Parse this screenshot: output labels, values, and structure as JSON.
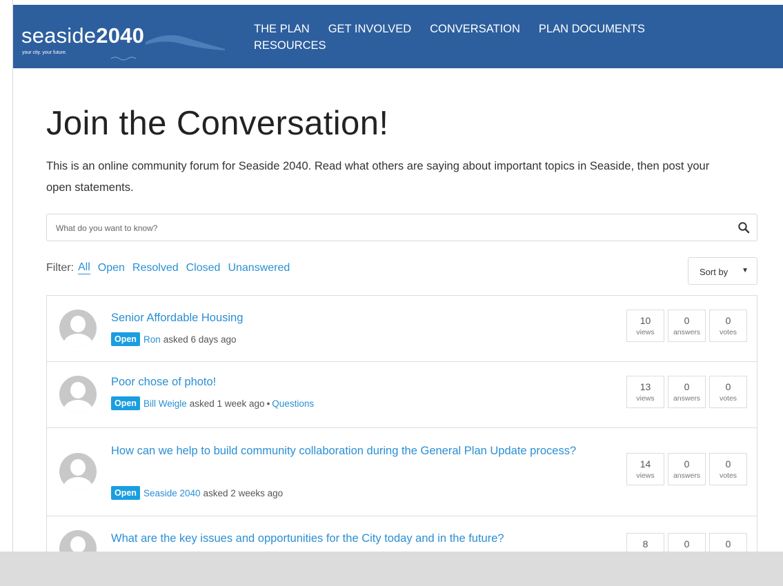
{
  "brand": {
    "logo_light": "seaside",
    "logo_bold": "2040",
    "tagline": "your city. your future."
  },
  "nav": {
    "items": [
      {
        "label": "THE PLAN"
      },
      {
        "label": "GET INVOLVED"
      },
      {
        "label": "CONVERSATION"
      },
      {
        "label": "PLAN DOCUMENTS"
      },
      {
        "label": "RESOURCES"
      }
    ]
  },
  "page": {
    "title": "Join the Conversation!",
    "intro": "This is an online community forum for Seaside 2040. Read what others are saying about important topics in Seaside, then post your open statements."
  },
  "search": {
    "placeholder": "What do you want to know?",
    "icon": "search-icon"
  },
  "filter": {
    "label": "Filter:",
    "options": [
      "All",
      "Open",
      "Resolved",
      "Closed",
      "Unanswered"
    ],
    "selected": "All"
  },
  "sort": {
    "label": "Sort by"
  },
  "questions": [
    {
      "title": "Senior Affordable Housing",
      "status": "Open",
      "author": "Ron",
      "asked": "asked 6 days ago",
      "category": "",
      "views": "10",
      "views_label": "views",
      "answers": "0",
      "answers_label": "answers",
      "votes": "0",
      "votes_label": "votes"
    },
    {
      "title": "Poor chose of photo!",
      "status": "Open",
      "author": "Bill Weigle",
      "asked": "asked 1 week ago",
      "separator": "•",
      "category": "Questions",
      "views": "13",
      "views_label": "views",
      "answers": "0",
      "answers_label": "answers",
      "votes": "0",
      "votes_label": "votes"
    },
    {
      "title": "How can we help to build community collaboration during the General Plan Update process?",
      "status": "Open",
      "author": "Seaside 2040",
      "asked": "asked 2 weeks ago",
      "category": "",
      "views": "14",
      "views_label": "views",
      "answers": "0",
      "answers_label": "answers",
      "votes": "0",
      "votes_label": "votes"
    },
    {
      "title": "What are the key issues and opportunities for the City today and in the future?",
      "views": "8",
      "answers": "0",
      "votes": "0"
    }
  ],
  "colors": {
    "header_bg": "#2d5f9e",
    "link": "#2a8fd4",
    "badge": "#1a9ee0"
  }
}
